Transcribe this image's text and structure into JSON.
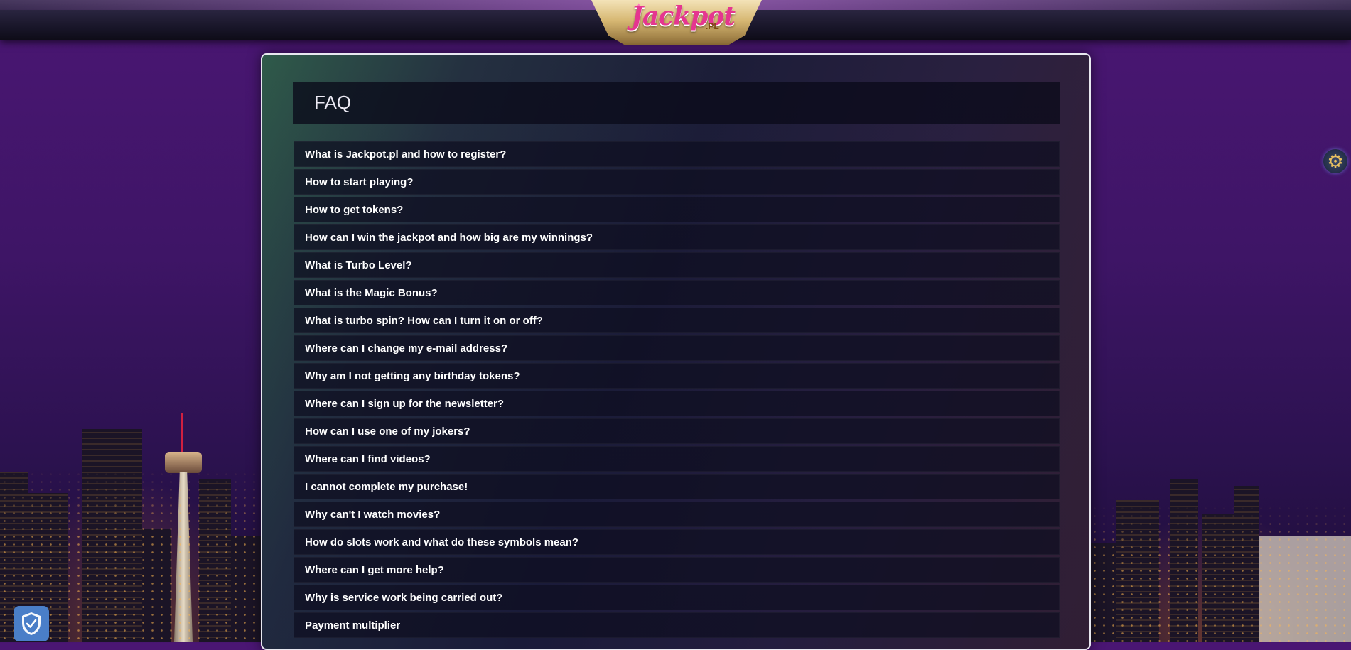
{
  "header": {
    "logo_text": "Jackpot",
    "logo_suffix": ".PL"
  },
  "faq": {
    "title": "FAQ",
    "items": [
      "What is Jackpot.pl and how to register?",
      "How to start playing?",
      "How to get tokens?",
      "How can I win the jackpot and how big are my winnings?",
      "What is Turbo Level?",
      "What is the Magic Bonus?",
      "What is turbo spin? How can I turn it on or off?",
      "Where can I change my e-mail address?",
      "Why am I not getting any birthday tokens?",
      "Where can I sign up for the newsletter?",
      "How can I use one of my jokers?",
      "Where can I find videos?",
      "I cannot complete my purchase!",
      "Why can't I watch movies?",
      "How do slots work and what do these symbols mean?",
      "Where can I get more help?",
      "Why is service work being carried out?",
      "Payment multiplier"
    ]
  },
  "icons": {
    "settings": "gear-icon",
    "privacy": "shield-check-icon"
  },
  "colors": {
    "background": "#3e1566",
    "logo_pink": "#e5368f",
    "privacy_button": "#4a7ec8"
  }
}
